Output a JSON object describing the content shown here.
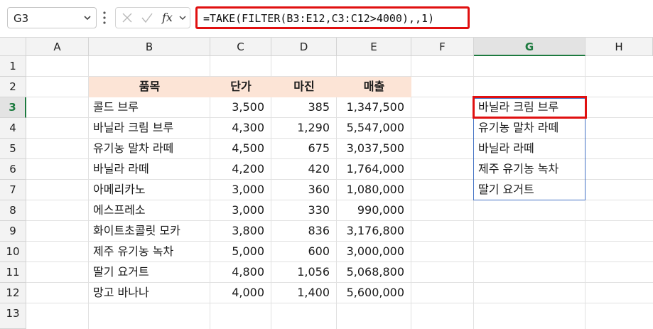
{
  "name_box": {
    "value": "G3"
  },
  "formula": {
    "text": "=TAKE(FILTER(B3:E12,C3:C12>4000),,1)"
  },
  "columns": [
    "A",
    "B",
    "C",
    "D",
    "E",
    "F",
    "G",
    "H"
  ],
  "rows": [
    "1",
    "2",
    "3",
    "4",
    "5",
    "6",
    "7",
    "8",
    "9",
    "10",
    "11",
    "12",
    "13"
  ],
  "table": {
    "headers": [
      "품목",
      "단가",
      "마진",
      "매출"
    ],
    "rows": [
      [
        "콜드 브루",
        "3,500",
        "385",
        "1,347,500"
      ],
      [
        "바닐라 크림 브루",
        "4,300",
        "1,290",
        "5,547,000"
      ],
      [
        "유기농 말차 라떼",
        "4,500",
        "675",
        "3,037,500"
      ],
      [
        "바닐라 라떼",
        "4,200",
        "420",
        "1,764,000"
      ],
      [
        "아메리카노",
        "3,000",
        "360",
        "1,080,000"
      ],
      [
        "에스프레소",
        "3,000",
        "330",
        "990,000"
      ],
      [
        "화이트초콜릿 모카",
        "3,800",
        "836",
        "3,176,800"
      ],
      [
        "제주 유기농 녹차",
        "5,000",
        "600",
        "3,000,000"
      ],
      [
        "딸기 요거트",
        "4,800",
        "1,056",
        "5,068,800"
      ],
      [
        "망고 바나나",
        "4,000",
        "1,400",
        "5,600,000"
      ]
    ]
  },
  "result": [
    "바닐라 크림 브루",
    "유기농 말차 라떼",
    "바닐라 라떼",
    "제주 유기농 녹차",
    "딸기 요거트"
  ],
  "colors": {
    "header_fill": "#fce4d6",
    "highlight": "#e01010",
    "spill_border": "#4472c4",
    "selection": "#1d7a3f"
  }
}
